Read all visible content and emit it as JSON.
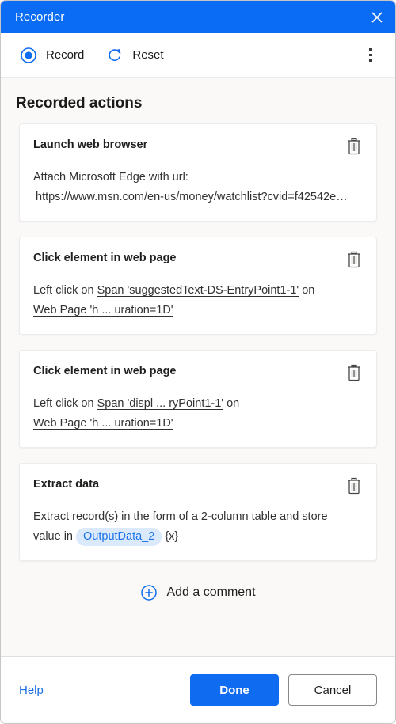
{
  "window": {
    "title": "Recorder",
    "controls": {
      "minimize": "minimize",
      "maximize": "maximize",
      "close": "close"
    },
    "accent_color": "#0a6cf5"
  },
  "toolbar": {
    "record_label": "Record",
    "reset_label": "Reset",
    "more_options": "more-options"
  },
  "main": {
    "section_title": "Recorded actions",
    "cards": [
      {
        "title": "Launch web browser",
        "line1": "Attach Microsoft Edge with url:",
        "line2": "https://www.msn.com/en-us/money/watchlist?cvid=f42542e…",
        "delete_label": "delete"
      },
      {
        "title": "Click element in web page",
        "line1_prefix": "Left click on ",
        "line1_link": "Span 'suggestedText-DS-EntryPoint1-1'",
        "line1_suffix": " on",
        "line2_link": "Web Page 'h ... uration=1D'",
        "delete_label": "delete"
      },
      {
        "title": "Click element in web page",
        "line1_prefix": "Left click on ",
        "line1_link": "Span 'displ ... ryPoint1-1'",
        "line1_suffix": " on",
        "line2_link": "Web Page 'h ... uration=1D'",
        "delete_label": "delete"
      },
      {
        "title": "Extract data",
        "line1": "Extract record(s) in the form of a 2-column table and store",
        "line2_prefix": "value in",
        "variable": "OutputData_2",
        "variable_marker": "{x}",
        "delete_label": "delete"
      }
    ],
    "add_comment_label": "Add a comment"
  },
  "footer": {
    "help_label": "Help",
    "done_label": "Done",
    "cancel_label": "Cancel"
  },
  "colors": {
    "title_bar": "#0a6cf5",
    "primary_button": "#0f6cf0",
    "link": "#1a6fe0",
    "variable_pill_bg": "#dbe9fd",
    "variable_pill_text": "#1a73e8",
    "page_bg": "#faf9f8"
  }
}
